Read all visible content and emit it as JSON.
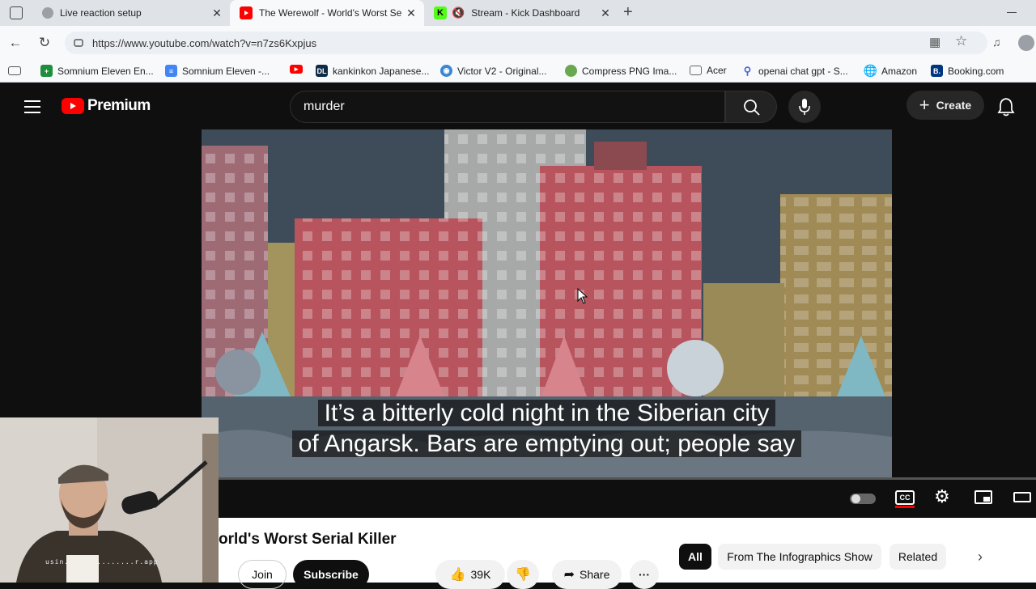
{
  "tabs": [
    {
      "title": "Live reaction setup",
      "active": false
    },
    {
      "title": "The Werewolf - World's Worst Se",
      "active": true
    },
    {
      "title": "Stream - Kick Dashboard",
      "active": false
    }
  ],
  "address": {
    "url": "https://www.youtube.com/watch?v=n7zs6Kxpjus"
  },
  "bookmarks": [
    {
      "label": "Somnium Eleven En...",
      "icon": "sheets-icon",
      "color": "#1e8e3e"
    },
    {
      "label": "Somnium Eleven -...",
      "icon": "docs-icon",
      "color": "#4285f4"
    },
    {
      "label": "",
      "icon": "youtube-icon",
      "color": "#ff0000"
    },
    {
      "label": "kankinkon Japanese...",
      "icon": "deepl-icon",
      "color": "#0f2b46"
    },
    {
      "label": "Victor V2 - Original...",
      "icon": "bot-icon",
      "color": "#3a87d6"
    },
    {
      "label": "Compress PNG Ima...",
      "icon": "panda-icon",
      "color": "#6aa84f"
    },
    {
      "label": "Acer",
      "icon": "folder-icon",
      "color": "#666666"
    },
    {
      "label": "openai chat gpt - S...",
      "icon": "search-icon",
      "color": "#4a63d8"
    },
    {
      "label": "Amazon",
      "icon": "globe-icon",
      "color": "#444444"
    },
    {
      "label": "Booking.com",
      "icon": "booking-icon",
      "color": "#003580"
    }
  ],
  "youtube": {
    "logo_text": "Premium",
    "search_value": "murder",
    "create_label": "Create"
  },
  "video": {
    "caption_line1": "It’s a bitterly cold night in the Siberian city",
    "caption_line2": "of Angarsk. Bars are emptying out; people say"
  },
  "below": {
    "title": "orld's Worst Serial Killer",
    "join_label": "Join",
    "subscribe_label": "Subscribe",
    "likes": "39K",
    "share_label": "Share",
    "chips": [
      "All",
      "From The Infographics Show",
      "Related"
    ]
  },
  "webcam": {
    "overlay_text": "usin...............r.app"
  },
  "colors": {
    "yt_red": "#ff0000",
    "kick_green": "#53fc18"
  }
}
